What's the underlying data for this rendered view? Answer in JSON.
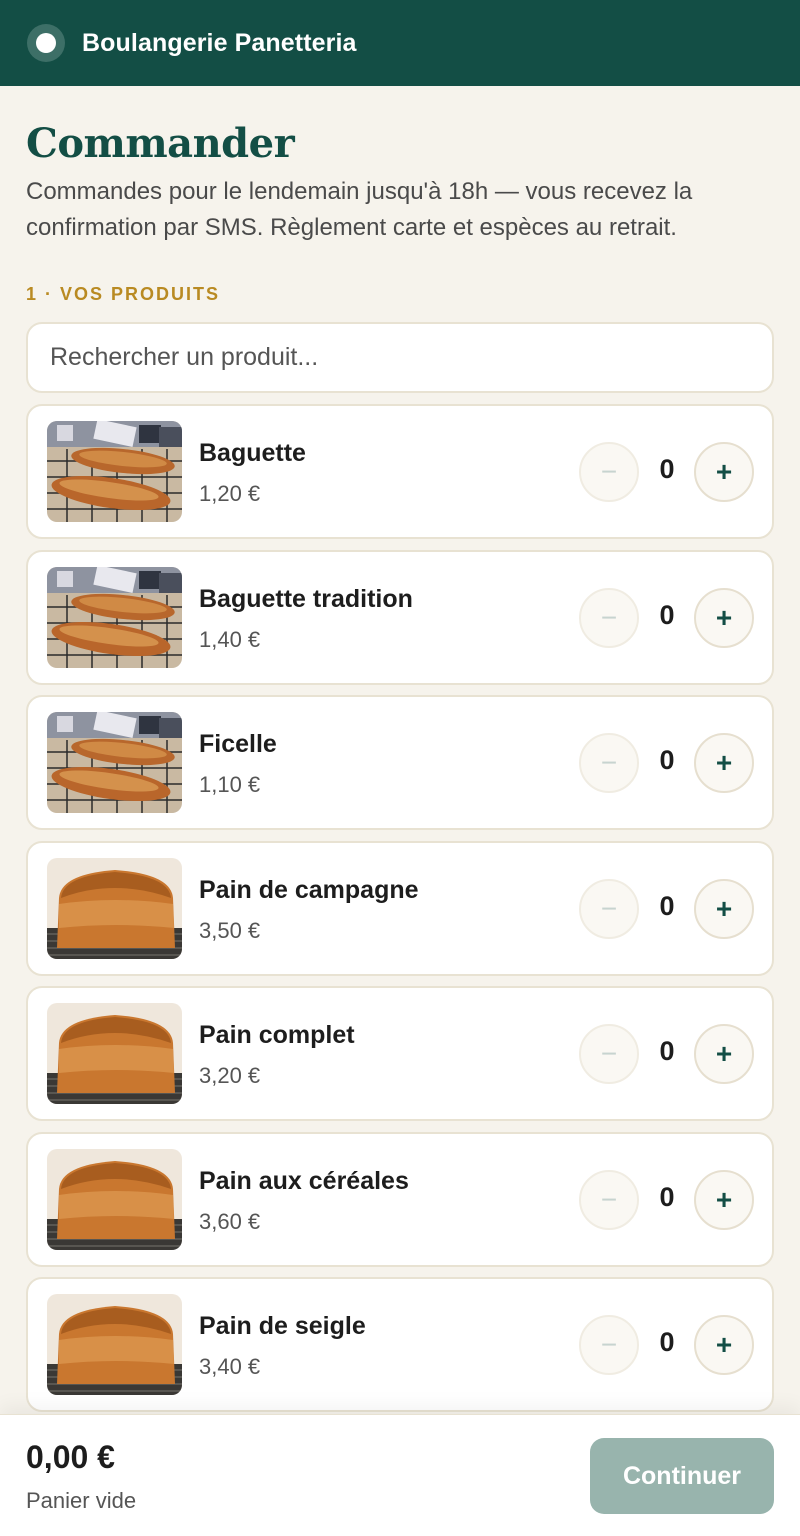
{
  "header": {
    "brand": "Boulangerie Panetteria",
    "logo_icon": "circle-logo-icon"
  },
  "main": {
    "title": "Commander",
    "intro": "Commandes pour le lendemain jusqu'à 18h — vous recevez la confirmation par SMS. Règlement carte et espèces au retrait.",
    "section_label": "1 · VOS PRODUITS",
    "search": {
      "placeholder": "Rechercher un produit...",
      "value": ""
    },
    "products": [
      {
        "name": "Baguette",
        "price": "1,20 €",
        "qty": "0",
        "image": "baguette-photo"
      },
      {
        "name": "Baguette tradition",
        "price": "1,40 €",
        "qty": "0",
        "image": "baguette-photo"
      },
      {
        "name": "Ficelle",
        "price": "1,10 €",
        "qty": "0",
        "image": "baguette-photo"
      },
      {
        "name": "Pain de campagne",
        "price": "3,50 €",
        "qty": "0",
        "image": "loaf-photo"
      },
      {
        "name": "Pain complet",
        "price": "3,20 €",
        "qty": "0",
        "image": "loaf-photo"
      },
      {
        "name": "Pain aux céréales",
        "price": "3,60 €",
        "qty": "0",
        "image": "loaf-photo"
      },
      {
        "name": "Pain de seigle",
        "price": "3,40 €",
        "qty": "0",
        "image": "loaf-photo"
      }
    ],
    "minus_symbol": "−",
    "plus_symbol": "+"
  },
  "footer": {
    "total": "0,00 €",
    "status": "Panier vide",
    "continue_label": "Continuer"
  },
  "colors": {
    "brand": "#134e45",
    "accent": "#b98a22",
    "background": "#f6f3ec",
    "button_disabled": "#98b4ad"
  }
}
